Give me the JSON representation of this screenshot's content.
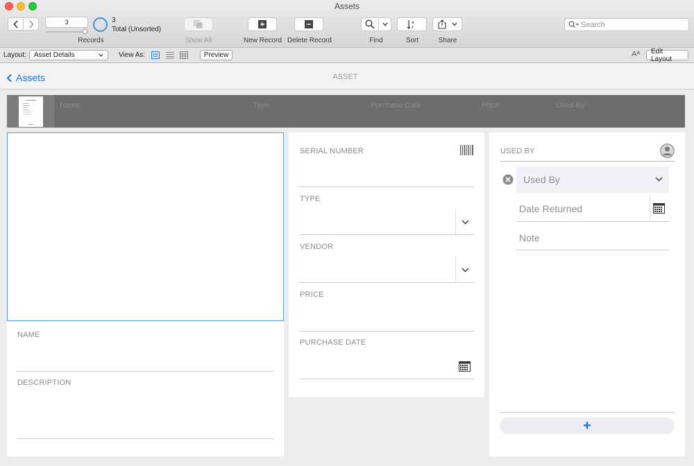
{
  "window": {
    "title": "Assets"
  },
  "toolbar": {
    "record_number": "3",
    "record_total": "3",
    "record_status": "Total (Unsorted)",
    "records_label": "Records",
    "show_all_label": "Show All",
    "new_record_label": "New Record",
    "delete_record_label": "Delete Record",
    "find_label": "Find",
    "sort_label": "Sort",
    "share_label": "Share",
    "search_placeholder": "Search"
  },
  "layout_bar": {
    "layout_label": "Layout:",
    "layout_value": "Asset Details",
    "view_as_label": "View As:",
    "preview_label": "Preview",
    "edit_layout_label": "Edit Layout"
  },
  "nav": {
    "back_label": "Assets",
    "page_title": "ASSET"
  },
  "list_header": {
    "columns": [
      "Name",
      "Type",
      "Purchase Date",
      "Price",
      "Used By"
    ]
  },
  "form": {
    "name_label": "NAME",
    "description_label": "DESCRIPTION",
    "serial_number_label": "SERIAL NUMBER",
    "type_label": "TYPE",
    "vendor_label": "VENDOR",
    "price_label": "PRICE",
    "purchase_date_label": "PURCHASE DATE"
  },
  "used_by": {
    "section_label": "USED BY",
    "used_by_placeholder": "Used By",
    "date_returned_placeholder": "Date Returned",
    "note_placeholder": "Note",
    "add_symbol": "+"
  },
  "colors": {
    "accent": "#1a73e8",
    "dark_band": "#6d6d6d",
    "window_bg": "#ececec"
  }
}
